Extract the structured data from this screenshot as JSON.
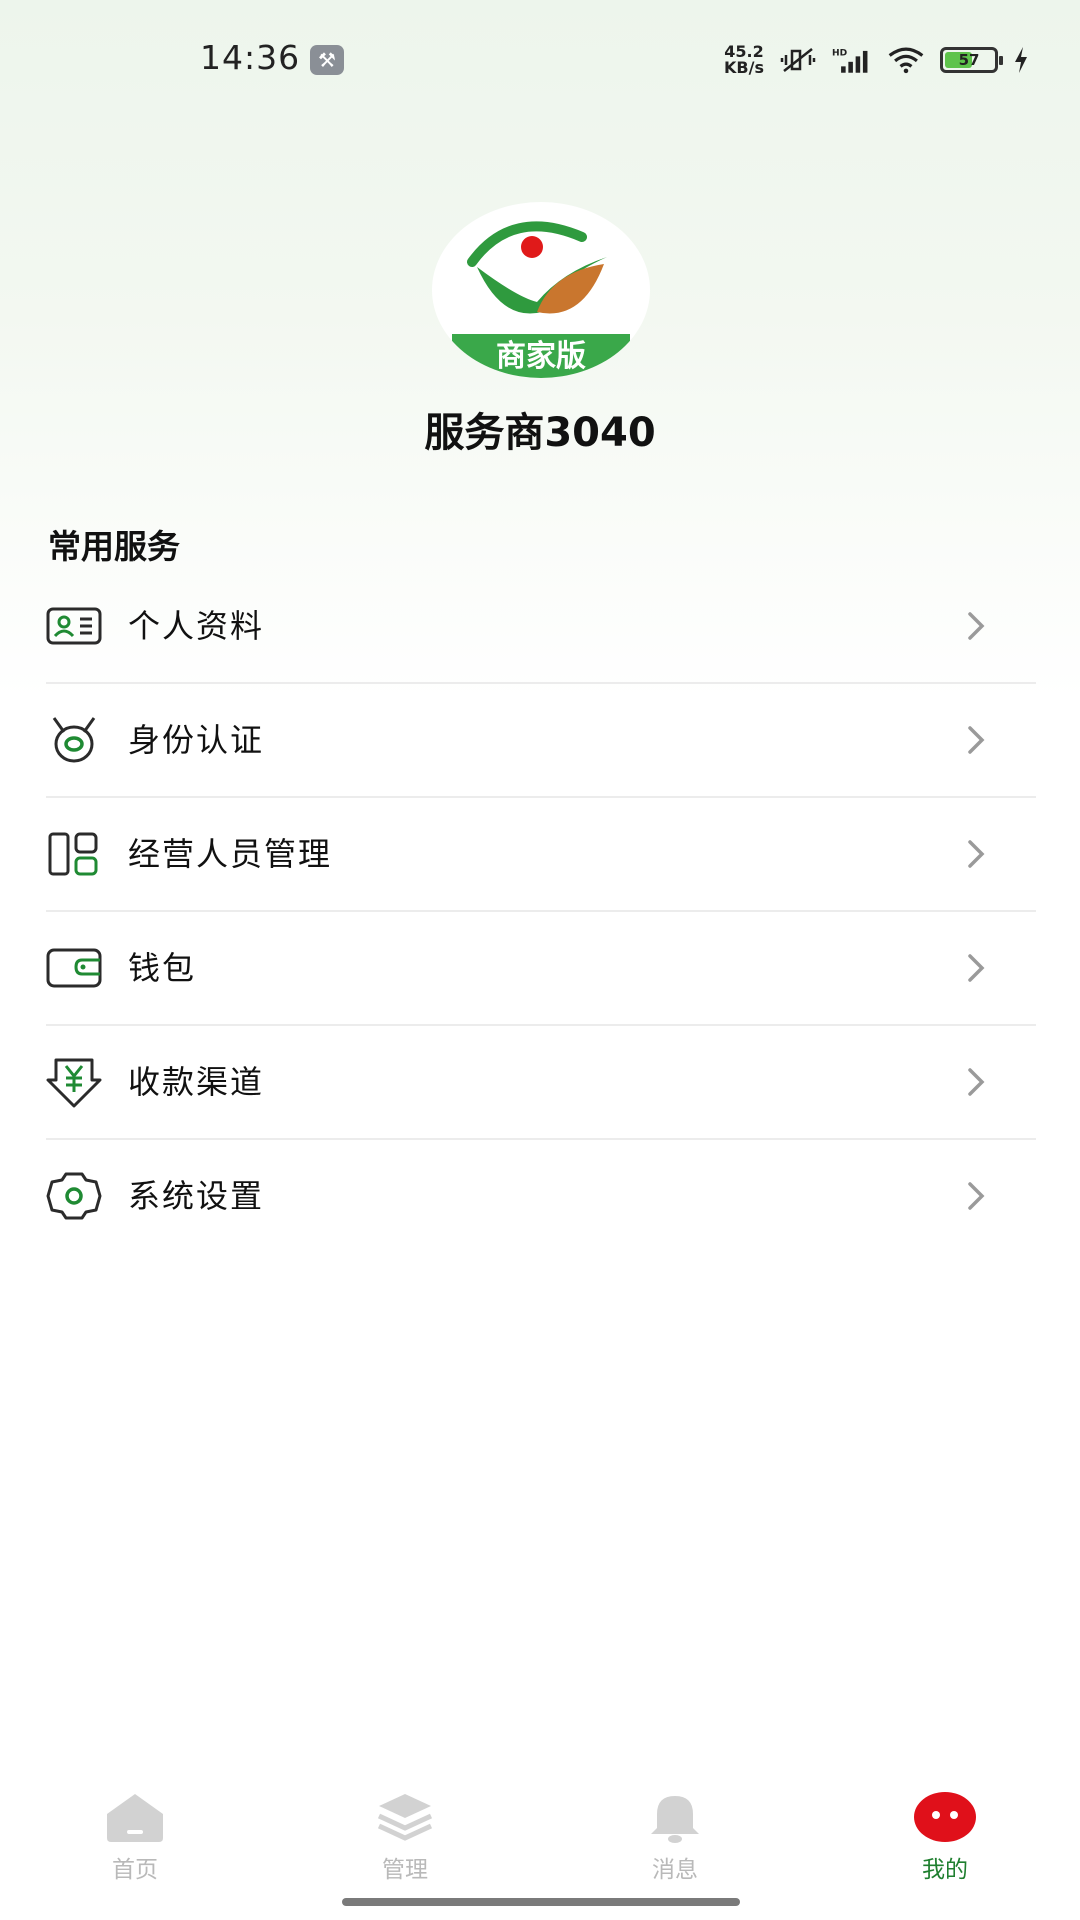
{
  "status_bar": {
    "time": "14:36",
    "net_speed_value": "45.2",
    "net_speed_unit": "KB/s",
    "battery_level": "57",
    "battery_fraction": 0.57,
    "network_label": "HD"
  },
  "profile": {
    "avatar_badge": "商家版",
    "name": "服务商3040"
  },
  "section": {
    "title": "常用服务"
  },
  "menu": {
    "items": [
      {
        "label": "个人资料",
        "icon": "id-card-icon"
      },
      {
        "label": "身份认证",
        "icon": "medal-icon"
      },
      {
        "label": "经营人员管理",
        "icon": "staff-grid-icon"
      },
      {
        "label": "钱包",
        "icon": "wallet-icon"
      },
      {
        "label": "收款渠道",
        "icon": "yuan-receipt-icon"
      },
      {
        "label": "系统设置",
        "icon": "gear-icon"
      }
    ]
  },
  "bottom_nav": {
    "items": [
      {
        "label": "首页",
        "icon": "home-icon",
        "active": false
      },
      {
        "label": "管理",
        "icon": "layers-icon",
        "active": false
      },
      {
        "label": "消息",
        "icon": "bell-icon",
        "active": false
      },
      {
        "label": "我的",
        "icon": "profile-face-icon",
        "active": true
      }
    ]
  },
  "colors": {
    "accent_green": "#1f7f2f",
    "icon_dark": "#2b2b2b",
    "nav_inactive": "#cfcfcf",
    "nav_active_icon": "#e0101a"
  }
}
